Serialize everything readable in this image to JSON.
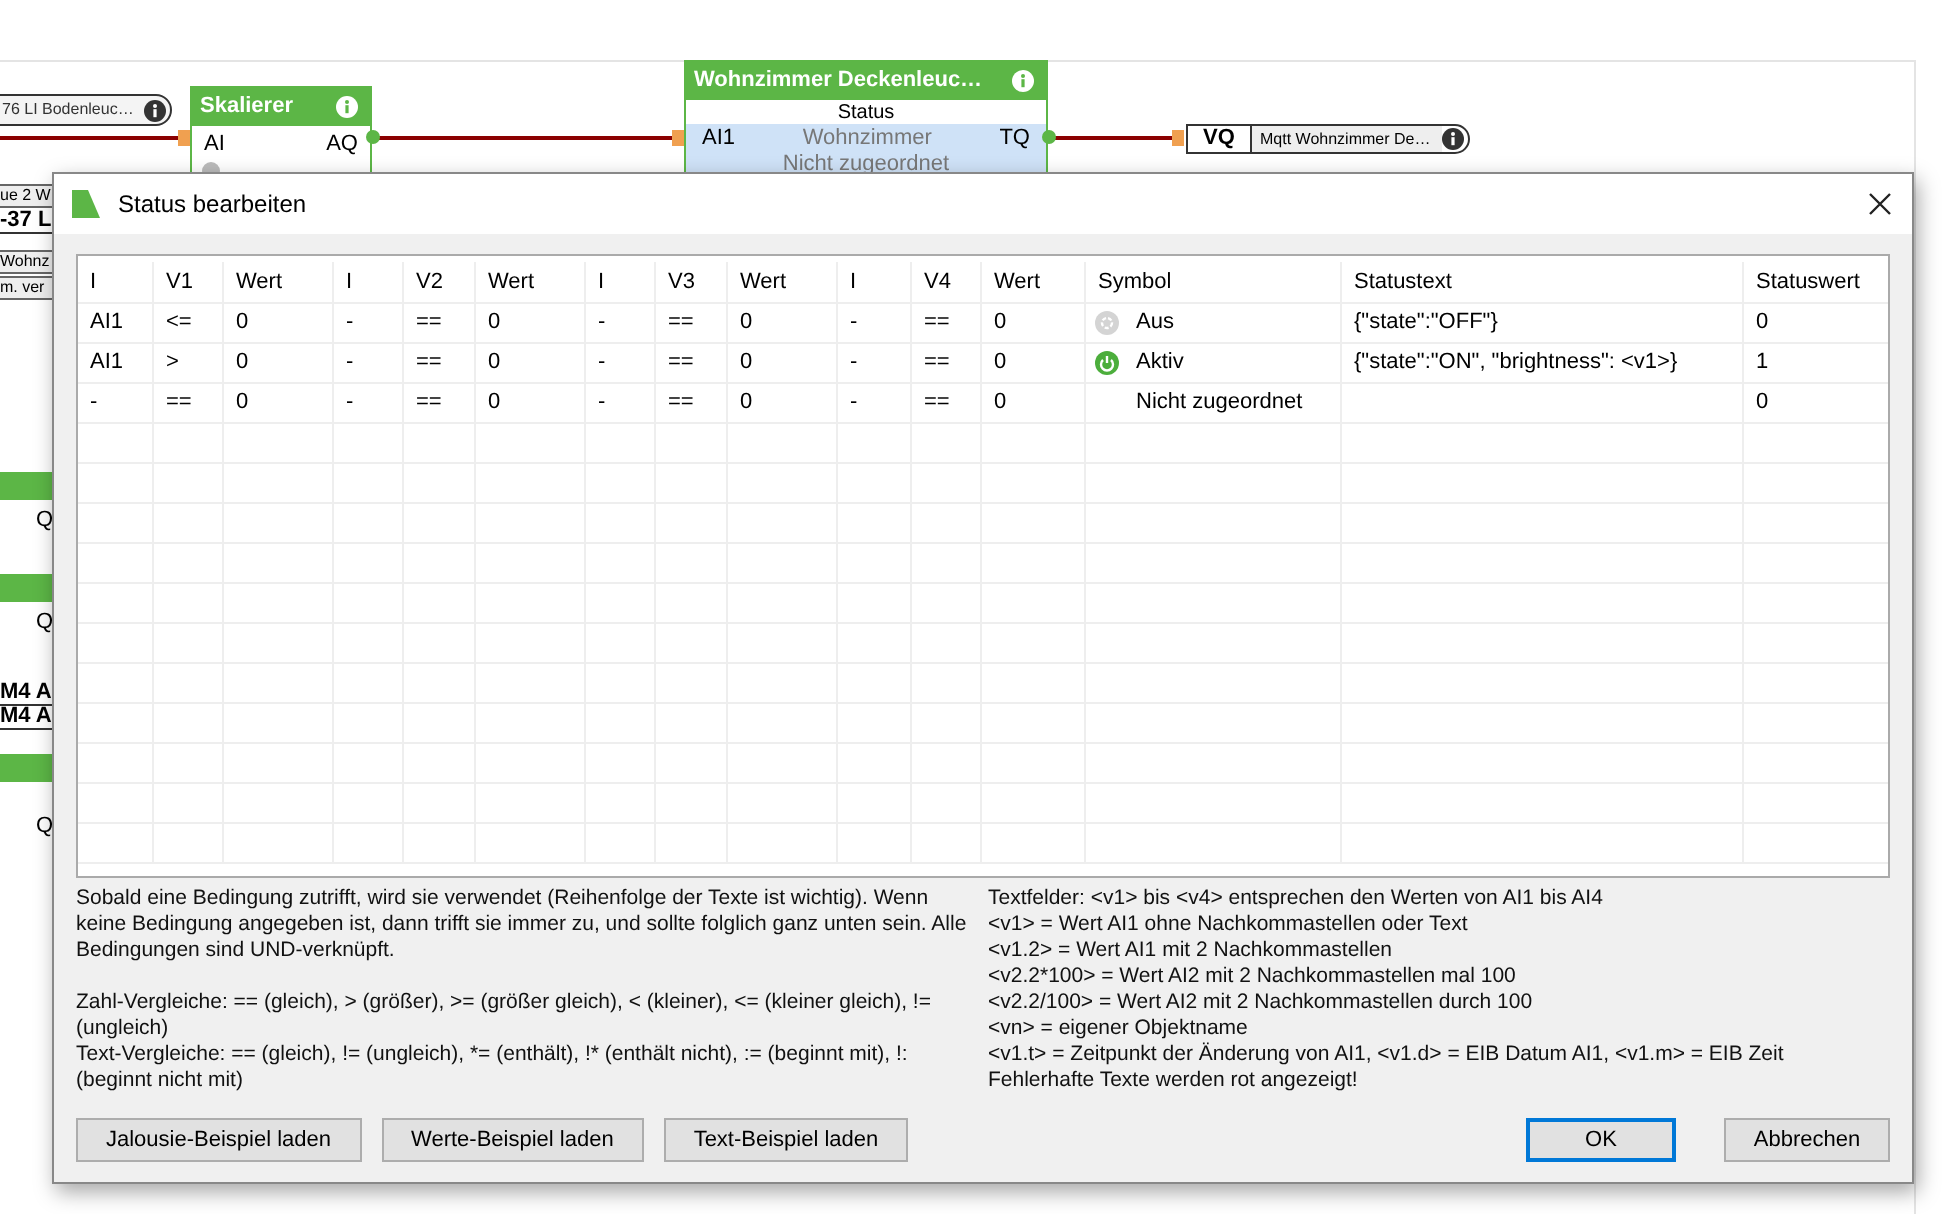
{
  "canvas": {
    "input_tag": {
      "text": "76  LI  Bodenleuc…"
    },
    "skalierer": {
      "title": "Skalierer",
      "input": "AI",
      "output": "AQ"
    },
    "status_block": {
      "title": "Wohnzimmer Deckenleuc…",
      "subtitle": "Status",
      "input": "AI1",
      "input_text": "Wohnzimmer",
      "output": "TQ",
      "row2_text": "Nicht zugeordnet"
    },
    "output_tag": {
      "label": "VQ",
      "text": "Mqtt Wohnzimmer De…"
    },
    "left_fragments": [
      {
        "kind": "tag",
        "text": "ue 2 W"
      },
      {
        "kind": "bold",
        "text": "-37 L"
      },
      {
        "kind": "tag",
        "text": "Wohnz"
      },
      {
        "kind": "tag",
        "text": "m. ver"
      },
      {
        "kind": "bar"
      },
      {
        "kind": "port",
        "text": "Q"
      },
      {
        "kind": "bar"
      },
      {
        "kind": "port",
        "text": "Q"
      },
      {
        "kind": "bold",
        "text": "M4 A"
      },
      {
        "kind": "bold",
        "text": "M4 A"
      },
      {
        "kind": "bar"
      },
      {
        "kind": "port",
        "text": "Q"
      }
    ]
  },
  "dialog": {
    "title": "Status bearbeiten",
    "columns": [
      "I",
      "V1",
      "Wert",
      "I",
      "V2",
      "Wert",
      "I",
      "V3",
      "Wert",
      "I",
      "V4",
      "Wert",
      "Symbol",
      "Statustext",
      "Statuswert"
    ],
    "rows": [
      {
        "cells": [
          "AI1",
          "<=",
          "0",
          "-",
          "==",
          "0",
          "-",
          "==",
          "0",
          "-",
          "==",
          "0"
        ],
        "symbol": {
          "kind": "off",
          "label": "Aus"
        },
        "statustext": "{\"state\":\"OFF\"}",
        "statuswert": "0"
      },
      {
        "cells": [
          "AI1",
          ">",
          "0",
          "-",
          "==",
          "0",
          "-",
          "==",
          "0",
          "-",
          "==",
          "0"
        ],
        "symbol": {
          "kind": "on",
          "label": "Aktiv"
        },
        "statustext": "{\"state\":\"ON\", \"brightness\": <v1>}",
        "statuswert": "1"
      },
      {
        "cells": [
          "-",
          "==",
          "0",
          "-",
          "==",
          "0",
          "-",
          "==",
          "0",
          "-",
          "==",
          "0"
        ],
        "symbol": {
          "kind": "none",
          "label": "Nicht zugeordnet"
        },
        "statustext": "",
        "statuswert": "0"
      }
    ],
    "help_left": [
      "Sobald eine Bedingung zutrifft, wird sie verwendet (Reihenfolge der Texte ist wichtig). Wenn keine Bedingung angegeben ist, dann trifft sie immer zu, und sollte folglich ganz unten sein. Alle Bedingungen sind UND-verknüpft.",
      "Zahl-Vergleiche: == (gleich), > (größer), >= (größer gleich), < (kleiner), <= (kleiner gleich), != (ungleich)",
      "Text-Vergleiche: == (gleich), != (ungleich), *= (enthält), !* (enthält nicht), := (beginnt mit), !: (beginnt nicht mit)"
    ],
    "help_right": [
      "Textfelder: <v1> bis <v4> entsprechen den Werten von AI1 bis AI4",
      "<v1> = Wert AI1 ohne Nachkommastellen oder Text",
      "<v1.2> = Wert AI1 mit 2 Nachkommastellen",
      "<v2.2*100> = Wert AI2 mit 2 Nachkommastellen mal 100",
      "<v2.2/100> = Wert AI2 mit 2 Nachkommastellen durch 100",
      "<vn> = eigener Objektname",
      "<v1.t> = Zeitpunkt der Änderung von AI1, <v1.d> = EIB Datum AI1, <v1.m> = EIB Zeit",
      "Fehlerhafte Texte werden rot angezeigt!"
    ],
    "left_buttons": [
      "Jalousie-Beispiel laden",
      "Werte-Beispiel laden",
      "Text-Beispiel laden"
    ],
    "ok_button": "OK",
    "cancel_button": "Abbrechen"
  }
}
